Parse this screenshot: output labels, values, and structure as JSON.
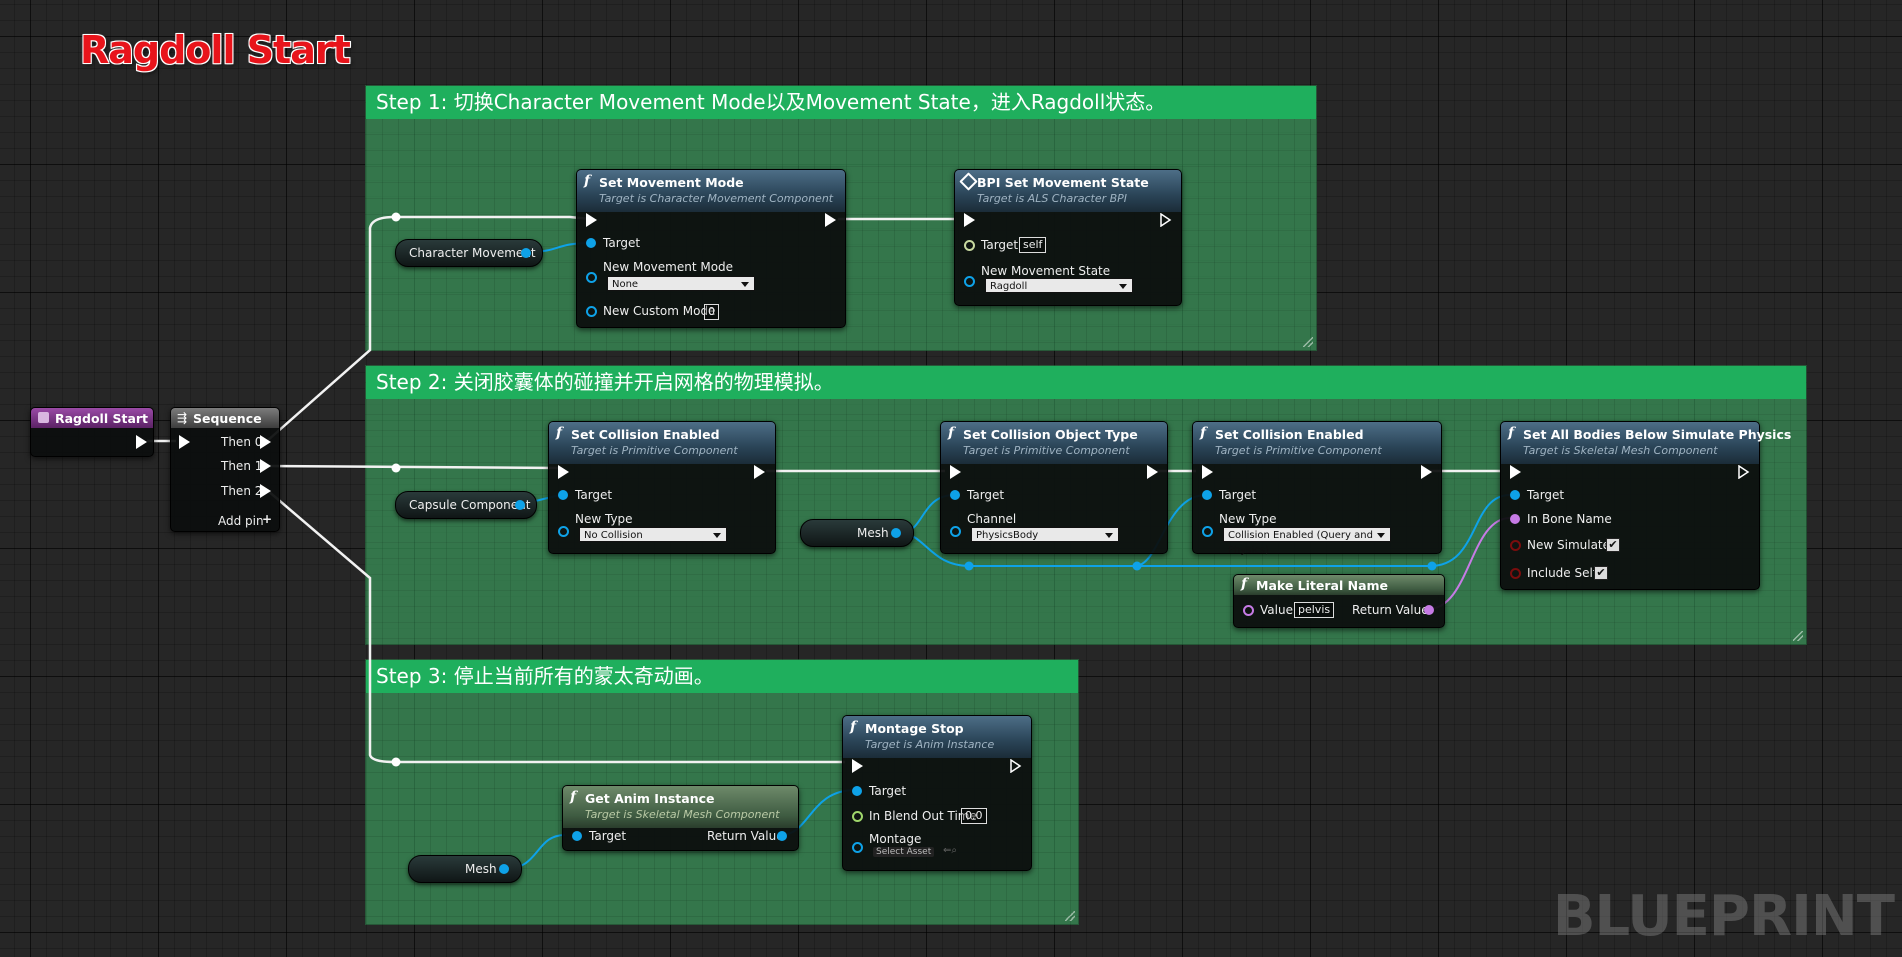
{
  "graph_title": "Ragdoll Start",
  "watermark": "BLUEPRINT",
  "comments": {
    "step1": "Step 1: 切换Character Movement Mode以及Movement State，进入Ragdoll状态。",
    "step2": "Step 2: 关闭胶囊体的碰撞并开启网格的物理模拟。",
    "step3": "Step 3: 停止当前所有的蒙太奇动画。"
  },
  "event_node": {
    "title": "Ragdoll Start"
  },
  "sequence_node": {
    "title": "Sequence",
    "then0": "Then 0",
    "then1": "Then 1",
    "then2": "Then 2",
    "add_pin": "Add pin"
  },
  "getters": {
    "character_movement": "Character Movement",
    "capsule_component": "Capsule Component",
    "mesh_step2": "Mesh",
    "mesh_step3": "Mesh"
  },
  "set_movement_mode": {
    "title": "Set Movement Mode",
    "subtitle": "Target is Character Movement Component",
    "target": "Target",
    "new_movement_mode": "New Movement Mode",
    "mode_value": "None",
    "new_custom_mode": "New Custom Mode",
    "custom_value": "0"
  },
  "bpi_set_movement_state": {
    "title": "BPI Set Movement State",
    "subtitle": "Target is ALS Character BPI",
    "target": "Target",
    "target_value": "self",
    "new_movement_state": "New Movement State",
    "state_value": "Ragdoll"
  },
  "set_collision_enabled_1": {
    "title": "Set Collision Enabled",
    "subtitle": "Target is Primitive Component",
    "target": "Target",
    "new_type": "New Type",
    "type_value": "No Collision"
  },
  "set_collision_object_type": {
    "title": "Set Collision Object Type",
    "subtitle": "Target is Primitive Component",
    "target": "Target",
    "channel": "Channel",
    "channel_value": "PhysicsBody"
  },
  "set_collision_enabled_2": {
    "title": "Set Collision Enabled",
    "subtitle": "Target is Primitive Component",
    "target": "Target",
    "new_type": "New Type",
    "type_value": "Collision Enabled (Query and Physics)"
  },
  "set_all_bodies": {
    "title": "Set All Bodies Below Simulate Physics",
    "subtitle": "Target is Skeletal Mesh Component",
    "target": "Target",
    "in_bone_name": "In Bone Name",
    "new_simulate": "New Simulate",
    "include_self": "Include Self"
  },
  "make_literal_name": {
    "title": "Make Literal Name",
    "value": "Value",
    "value_text": "pelvis",
    "return_value": "Return Value"
  },
  "montage_stop": {
    "title": "Montage Stop",
    "subtitle": "Target is Anim Instance",
    "target": "Target",
    "in_blend_out_time": "In Blend Out Time",
    "blend_value": "0.0",
    "montage": "Montage",
    "select_asset": "Select Asset"
  },
  "get_anim_instance": {
    "title": "Get Anim Instance",
    "subtitle": "Target is Skeletal Mesh Component",
    "target": "Target",
    "return_value": "Return Value"
  },
  "colors": {
    "comment_header": "#1faf5d",
    "object_pin": "#0ea2e8",
    "name_pin": "#c67be5",
    "title_red": "#e8141b"
  }
}
